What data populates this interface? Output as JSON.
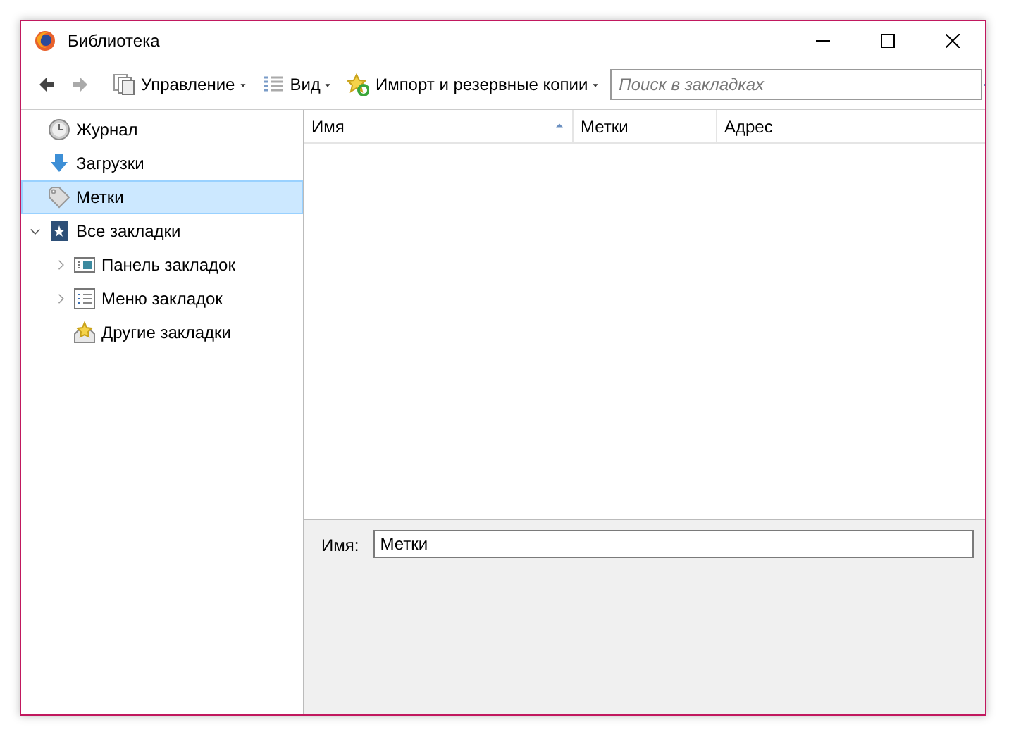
{
  "window": {
    "title": "Библиотека"
  },
  "toolbar": {
    "items": [
      {
        "label": "Управление",
        "kind": "organize"
      },
      {
        "label": "Вид",
        "kind": "view"
      },
      {
        "label": "Импорт и резервные копии",
        "kind": "import"
      }
    ],
    "search": {
      "placeholder": "Поиск в закладках"
    }
  },
  "sidebar": {
    "items": [
      {
        "label": "Журнал",
        "kind": "history",
        "selected": false
      },
      {
        "label": "Загрузки",
        "kind": "downloads",
        "selected": false
      },
      {
        "label": "Метки",
        "kind": "tags",
        "selected": true
      },
      {
        "label": "Все закладки",
        "kind": "all",
        "selected": false,
        "expanded": true,
        "children": [
          {
            "label": "Панель закладок",
            "kind": "toolbar",
            "selected": false,
            "expanded": false
          },
          {
            "label": "Меню закладок",
            "kind": "menu",
            "selected": false,
            "expanded": false
          },
          {
            "label": "Другие закладки",
            "kind": "other",
            "selected": false
          }
        ]
      }
    ]
  },
  "table": {
    "columns": [
      {
        "label": "Имя",
        "sorted": true
      },
      {
        "label": "Метки",
        "sorted": false
      },
      {
        "label": "Адрес",
        "sorted": false
      }
    ]
  },
  "details": {
    "label": "Имя:",
    "value": "Метки"
  }
}
